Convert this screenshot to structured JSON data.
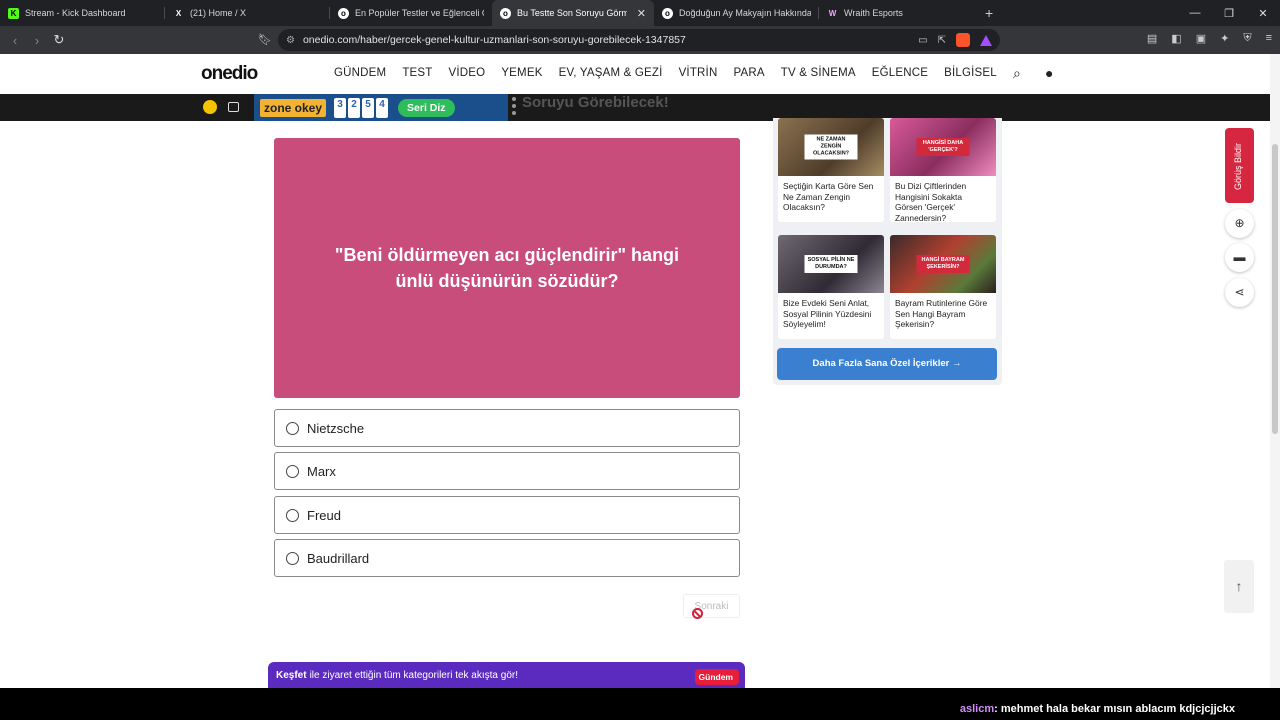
{
  "browser": {
    "tabs": [
      {
        "title": "Stream - Kick Dashboard",
        "favicon": "K",
        "favcolor": "#53fc18"
      },
      {
        "title": "(21) Home / X",
        "favicon": "X",
        "favcolor": "#000000"
      },
      {
        "title": "En Popüler Testler ve Eğlenceli Quizle",
        "favicon": "o",
        "favcolor": "#111111"
      },
      {
        "title": "Bu Testte Son Soruyu Görmek Ç",
        "favicon": "o",
        "favcolor": "#111111"
      },
      {
        "title": "Doğduğun Ay Makyajın Hakkında İpu",
        "favicon": "o",
        "favcolor": "#111111"
      },
      {
        "title": "Wraith Esports",
        "favicon": "W",
        "favcolor": "#7d2bd1"
      }
    ],
    "active_tab": 3,
    "url": "onedio.com/haber/gercek-genel-kultur-uzmanlari-son-soruyu-gorebilecek-1347857"
  },
  "site": {
    "logo": "onedio",
    "nav": [
      "GÜNDEM",
      "TEST",
      "VİDEO",
      "YEMEK",
      "EV, YAŞAM & GEZİ",
      "VİTRİN",
      "PARA",
      "TV & SİNEMA",
      "EĞLENCE",
      "BİLGİSEL"
    ]
  },
  "ad": {
    "brand": "zone okey",
    "tiles": [
      "3",
      "2",
      "5",
      "4"
    ],
    "cta": "Seri Diz",
    "behind_title": "Soruyu Görebilecek!"
  },
  "quiz": {
    "question": "\"Beni öldürmeyen acı güçlendirir\" hangi ünlü düşünürün sözüdür?",
    "options": [
      "Nietzsche",
      "Marx",
      "Freud",
      "Baudrillard"
    ],
    "next_label": "Sonraki"
  },
  "recommend": {
    "cards": [
      {
        "title": "Seçtiğin Karta Göre Sen Ne Zaman Zengin Olacaksın?",
        "stamp": "NE ZAMAN ZENGİN OLACAKSIN?"
      },
      {
        "title": "Bu Dizi Çiftlerinden Hangisini Sokakta Görsen 'Gerçek' Zannedersin?",
        "stamp": "HANGİSİ DAHA 'GERÇEK'?"
      },
      {
        "title": "Bize Evdeki Seni Anlat, Sosyal Pilinin Yüzdesini Söyleyelim!",
        "stamp": "SOSYAL PİLİN NE DURUMDA?"
      },
      {
        "title": "Bayram Rutinlerine Göre Sen Hangi Bayram Şekerisin?",
        "stamp": "HANGİ BAYRAM ŞEKERİSİN?"
      }
    ],
    "more_label": "Daha Fazla Sana Özel İçerikler →"
  },
  "sidebar": {
    "feedback": "Görüş Bildir"
  },
  "discover": {
    "bold": "Keşfet",
    "text": "ile ziyaret ettiğin tüm kategorileri tek akışta gör!",
    "badge": "Gündem"
  },
  "chat_overlay": {
    "user": "aslicm",
    "message": ": mehmet hala bekar mısın ablacım kdjcjcjjckx"
  }
}
